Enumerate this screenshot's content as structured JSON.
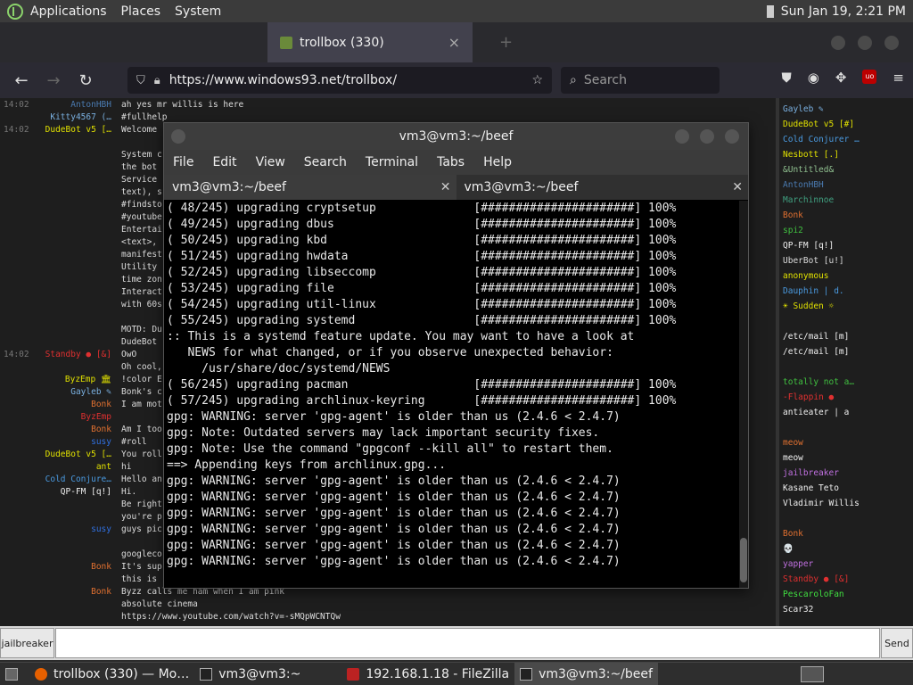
{
  "top_panel": {
    "menus": [
      "Applications",
      "Places",
      "System"
    ],
    "clock": "Sun Jan 19,  2:21 PM"
  },
  "browser": {
    "tab_active": "trollbox (330)",
    "url": "https://www.windows93.net/trollbox/",
    "search_placeholder": "Search"
  },
  "chat": {
    "rows": [
      {
        "time": "14:02",
        "nick": "AntonHBH",
        "color": "#4a7ab0",
        "msg": "ah yes mr willis is here"
      },
      {
        "time": "",
        "nick": "Kitty4567 (…",
        "color": "#7ab0e0",
        "msg": "#fullhelp"
      },
      {
        "time": "14:02",
        "nick": "DudeBot v5 […",
        "color": "#e0e000",
        "msg": "Welcome"
      },
      {
        "time": "",
        "nick": "",
        "color": "#ddd",
        "msg": ""
      },
      {
        "time": "",
        "nick": "",
        "color": "#ddd",
        "msg": "System c"
      },
      {
        "time": "",
        "nick": "",
        "color": "#ddd",
        "msg": "the bot"
      },
      {
        "time": "",
        "nick": "",
        "color": "#ddd",
        "msg": "Service"
      },
      {
        "time": "",
        "nick": "",
        "color": "#ddd",
        "msg": "text), s"
      },
      {
        "time": "",
        "nick": "",
        "color": "#ddd",
        "msg": "#findsto"
      },
      {
        "time": "",
        "nick": "",
        "color": "#ddd",
        "msg": "#youtube"
      },
      {
        "time": "",
        "nick": "",
        "color": "#ddd",
        "msg": "Entertai"
      },
      {
        "time": "",
        "nick": "",
        "color": "#ddd",
        "msg": "<text>,"
      },
      {
        "time": "",
        "nick": "",
        "color": "#ddd",
        "msg": "manifest"
      },
      {
        "time": "",
        "nick": "",
        "color": "#ddd",
        "msg": "Utility"
      },
      {
        "time": "",
        "nick": "",
        "color": "#ddd",
        "msg": "time zon"
      },
      {
        "time": "",
        "nick": "",
        "color": "#ddd",
        "msg": "Interact"
      },
      {
        "time": "",
        "nick": "",
        "color": "#ddd",
        "msg": "with 60s"
      },
      {
        "time": "",
        "nick": "",
        "color": "#ddd",
        "msg": ""
      },
      {
        "time": "",
        "nick": "",
        "color": "#ddd",
        "msg": "MOTD: Du"
      },
      {
        "time": "",
        "nick": "",
        "color": "#ddd",
        "msg": "DudeBot"
      },
      {
        "time": "14:02",
        "nick": "Standby ● [&]",
        "color": "#e03030",
        "msg": "OwO"
      },
      {
        "time": "",
        "nick": "",
        "color": "#3050e0",
        "msg": "Oh cool,"
      },
      {
        "time": "",
        "nick": "ByzEmp 🏛",
        "color": "#e0e000",
        "msg": "!color E"
      },
      {
        "time": "",
        "nick": "Gayleb ✎",
        "color": "#7ab0e0",
        "msg": "Bonk's c"
      },
      {
        "time": "",
        "nick": "Bonk",
        "color": "#e07030",
        "msg": "I am mot"
      },
      {
        "time": "",
        "nick": "ByzEmp",
        "color": "#e03030",
        "msg": ""
      },
      {
        "time": "",
        "nick": "Bonk",
        "color": "#e07030",
        "msg": "Am I too"
      },
      {
        "time": "",
        "nick": "susy",
        "color": "#3070e0",
        "msg": "#roll"
      },
      {
        "time": "",
        "nick": "DudeBot v5 […",
        "color": "#e0e000",
        "msg": "You roll"
      },
      {
        "time": "",
        "nick": "ant",
        "color": "#e0e000",
        "msg": "hi"
      },
      {
        "time": "",
        "nick": "Cold Conjure…",
        "color": "#4a9ae0",
        "msg": "Hello an"
      },
      {
        "time": "",
        "nick": "QP-FM [q!]",
        "color": "#f0f0f0",
        "msg": "Hi."
      },
      {
        "time": "",
        "nick": "",
        "color": "#3050e0",
        "msg": "Be right"
      },
      {
        "time": "",
        "nick": "",
        "color": "#e03030",
        "msg": "you're p"
      },
      {
        "time": "",
        "nick": "susy",
        "color": "#3070e0",
        "msg": "guys pic"
      },
      {
        "time": "",
        "nick": "",
        "color": "#e03030",
        "msg": ""
      },
      {
        "time": "",
        "nick": "",
        "color": "#e03030",
        "msg": "googleco"
      },
      {
        "time": "",
        "nick": "Bonk",
        "color": "#e07030",
        "msg": "It's sup"
      },
      {
        "time": "",
        "nick": "",
        "color": "#e03030",
        "msg": "this is"
      },
      {
        "time": "",
        "nick": "Bonk",
        "color": "#e07030",
        "msg": "Byzz calls me ham when I am pink"
      },
      {
        "time": "",
        "nick": "",
        "color": "#e03030",
        "msg": "absolute cinema"
      },
      {
        "time": "",
        "nick": "",
        "color": "#e03030",
        "msg": "https://www.youtube.com/watch?v=-sMQpWCNTQw"
      }
    ]
  },
  "users": [
    {
      "name": "Gayleb ✎",
      "color": "#7ab0e0"
    },
    {
      "name": "DudeBot v5 [#]",
      "color": "#e0e000"
    },
    {
      "name": "Cold Conjurer …",
      "color": "#4a9ae0"
    },
    {
      "name": "Nesbott [.]",
      "color": "#e0e000"
    },
    {
      "name": "&Untitled&",
      "color": "#90c090"
    },
    {
      "name": "AntonHBH",
      "color": "#4a7ab0"
    },
    {
      "name": "Marchinnoe",
      "color": "#40a080"
    },
    {
      "name": "Bonk",
      "color": "#e07030"
    },
    {
      "name": "spi2",
      "color": "#40c040"
    },
    {
      "name": "QP-FM [q!]",
      "color": "#f0f0f0"
    },
    {
      "name": "UberBot [u!]",
      "color": "#ddd"
    },
    {
      "name": "anonymous",
      "color": "#e0e000"
    },
    {
      "name": "Dauphin | d.",
      "color": "#4a9ae0"
    },
    {
      "name": "☀ Sudden ☼",
      "color": "#e0e000"
    },
    {
      "name": "",
      "color": "#3050e0"
    },
    {
      "name": "/etc/mail [m]",
      "color": "#f0f0f0"
    },
    {
      "name": "/etc/mail [m]",
      "color": "#f0f0f0"
    },
    {
      "name": "",
      "color": "#3050e0"
    },
    {
      "name": "totally not a…",
      "color": "#40c040"
    },
    {
      "name": "-Flappin ●",
      "color": "#e03030"
    },
    {
      "name": "antieater | a",
      "color": "#f0f0f0"
    },
    {
      "name": "",
      "color": "#e03030"
    },
    {
      "name": "meow",
      "color": "#e07030"
    },
    {
      "name": "meow",
      "color": "#f0f0f0"
    },
    {
      "name": "jailbreaker",
      "color": "#c070e0"
    },
    {
      "name": "Kasane Teto",
      "color": "#f0f0f0"
    },
    {
      "name": "Vladimir Willis",
      "color": "#f0f0f0"
    },
    {
      "name": "",
      "color": "#3050e0"
    },
    {
      "name": "Bonk",
      "color": "#e07030"
    },
    {
      "name": "💀",
      "color": "#f0f0f0"
    },
    {
      "name": "yapper",
      "color": "#c070e0"
    },
    {
      "name": "Standby ● [&]",
      "color": "#e03030"
    },
    {
      "name": "PescaroloFan",
      "color": "#40e040"
    },
    {
      "name": "Scar32",
      "color": "#f0f0f0"
    }
  ],
  "input": {
    "nick": "jailbreaker",
    "send": "Send"
  },
  "terminal": {
    "title": "vm3@vm3:~/beef",
    "menu": [
      "File",
      "Edit",
      "View",
      "Search",
      "Terminal",
      "Tabs",
      "Help"
    ],
    "tabs": [
      "vm3@vm3:~/beef",
      "vm3@vm3:~/beef"
    ],
    "lines": [
      "( 48/245) upgrading cryptsetup              [######################] 100%",
      "( 49/245) upgrading dbus                    [######################] 100%",
      "( 50/245) upgrading kbd                     [######################] 100%",
      "( 51/245) upgrading hwdata                  [######################] 100%",
      "( 52/245) upgrading libseccomp              [######################] 100%",
      "( 53/245) upgrading file                    [######################] 100%",
      "( 54/245) upgrading util-linux              [######################] 100%",
      "( 55/245) upgrading systemd                 [######################] 100%",
      ":: This is a systemd feature update. You may want to have a look at",
      "   NEWS for what changed, or if you observe unexpected behavior:",
      "     /usr/share/doc/systemd/NEWS",
      "( 56/245) upgrading pacman                  [######################] 100%",
      "( 57/245) upgrading archlinux-keyring       [######################] 100%",
      "gpg: WARNING: server 'gpg-agent' is older than us (2.4.6 < 2.4.7)",
      "gpg: Note: Outdated servers may lack important security fixes.",
      "gpg: Note: Use the command \"gpgconf --kill all\" to restart them.",
      "==> Appending keys from archlinux.gpg...",
      "gpg: WARNING: server 'gpg-agent' is older than us (2.4.6 < 2.4.7)",
      "gpg: WARNING: server 'gpg-agent' is older than us (2.4.6 < 2.4.7)",
      "gpg: WARNING: server 'gpg-agent' is older than us (2.4.6 < 2.4.7)",
      "gpg: WARNING: server 'gpg-agent' is older than us (2.4.6 < 2.4.7)",
      "gpg: WARNING: server 'gpg-agent' is older than us (2.4.6 < 2.4.7)",
      "gpg: WARNING: server 'gpg-agent' is older than us (2.4.6 < 2.4.7)"
    ]
  },
  "taskbar": {
    "items": [
      "trollbox (330) — Mo…",
      "vm3@vm3:~",
      "192.168.1.18 - FileZilla",
      "vm3@vm3:~/beef"
    ]
  }
}
